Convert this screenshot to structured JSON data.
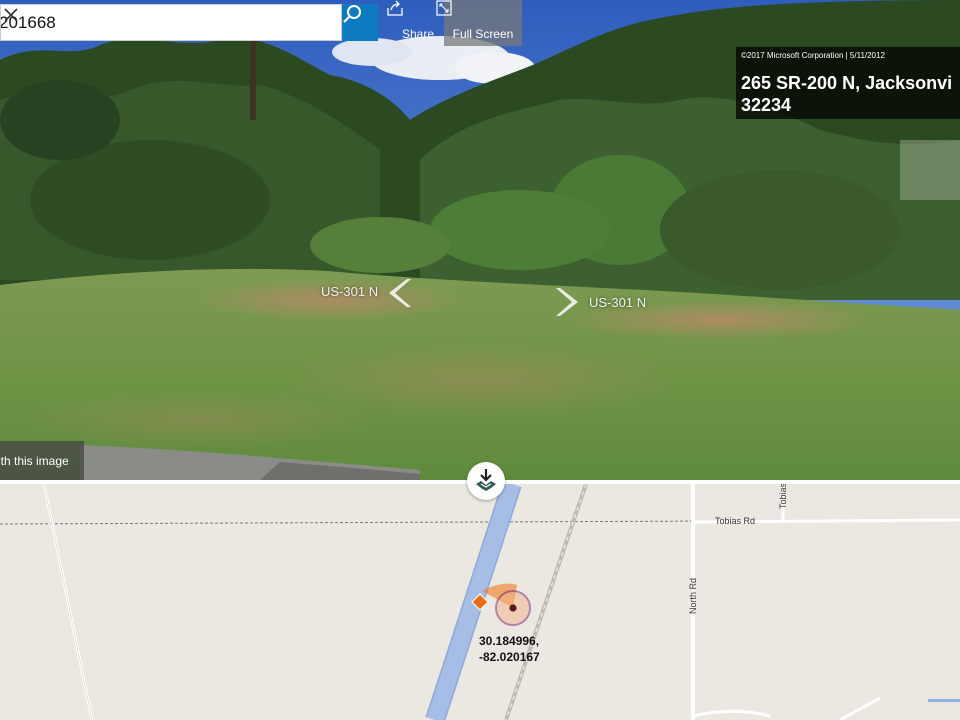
{
  "search": {
    "value": "201668"
  },
  "toolbar": {
    "share_label": "Share",
    "fullscreen_label": "Full Screen"
  },
  "info": {
    "copyright": "©2017 Microsoft Corporation | 5/11/2012",
    "address_line1": "265 SR-200 N, Jacksonvi",
    "address_line2": "32234"
  },
  "navigation": {
    "left_label": "US-301 N",
    "right_label": "US-301 N"
  },
  "feedback": {
    "label": "ith this image"
  },
  "map": {
    "road_tobias_h": "Tobias Rd",
    "road_tobias_v": "Tobias",
    "road_north": "North Rd",
    "coord_lat": "30.184996,",
    "coord_lon": "-82.020167"
  },
  "colors": {
    "search_button": "#0d7ac2",
    "map_bg": "#ebe8e2",
    "highway": "#a6bde6",
    "marker_orange": "#f07a1a",
    "marker_circle": "#7a1f6e"
  }
}
